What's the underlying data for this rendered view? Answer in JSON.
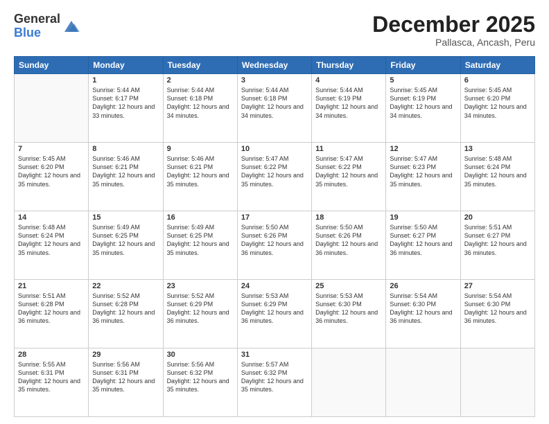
{
  "logo": {
    "general": "General",
    "blue": "Blue"
  },
  "title": "December 2025",
  "subtitle": "Pallasca, Ancash, Peru",
  "days_of_week": [
    "Sunday",
    "Monday",
    "Tuesday",
    "Wednesday",
    "Thursday",
    "Friday",
    "Saturday"
  ],
  "weeks": [
    [
      {
        "day": "",
        "sunrise": "",
        "sunset": "",
        "daylight": ""
      },
      {
        "day": "1",
        "sunrise": "Sunrise: 5:44 AM",
        "sunset": "Sunset: 6:17 PM",
        "daylight": "Daylight: 12 hours and 33 minutes."
      },
      {
        "day": "2",
        "sunrise": "Sunrise: 5:44 AM",
        "sunset": "Sunset: 6:18 PM",
        "daylight": "Daylight: 12 hours and 34 minutes."
      },
      {
        "day": "3",
        "sunrise": "Sunrise: 5:44 AM",
        "sunset": "Sunset: 6:18 PM",
        "daylight": "Daylight: 12 hours and 34 minutes."
      },
      {
        "day": "4",
        "sunrise": "Sunrise: 5:44 AM",
        "sunset": "Sunset: 6:19 PM",
        "daylight": "Daylight: 12 hours and 34 minutes."
      },
      {
        "day": "5",
        "sunrise": "Sunrise: 5:45 AM",
        "sunset": "Sunset: 6:19 PM",
        "daylight": "Daylight: 12 hours and 34 minutes."
      },
      {
        "day": "6",
        "sunrise": "Sunrise: 5:45 AM",
        "sunset": "Sunset: 6:20 PM",
        "daylight": "Daylight: 12 hours and 34 minutes."
      }
    ],
    [
      {
        "day": "7",
        "sunrise": "Sunrise: 5:45 AM",
        "sunset": "Sunset: 6:20 PM",
        "daylight": "Daylight: 12 hours and 35 minutes."
      },
      {
        "day": "8",
        "sunrise": "Sunrise: 5:46 AM",
        "sunset": "Sunset: 6:21 PM",
        "daylight": "Daylight: 12 hours and 35 minutes."
      },
      {
        "day": "9",
        "sunrise": "Sunrise: 5:46 AM",
        "sunset": "Sunset: 6:21 PM",
        "daylight": "Daylight: 12 hours and 35 minutes."
      },
      {
        "day": "10",
        "sunrise": "Sunrise: 5:47 AM",
        "sunset": "Sunset: 6:22 PM",
        "daylight": "Daylight: 12 hours and 35 minutes."
      },
      {
        "day": "11",
        "sunrise": "Sunrise: 5:47 AM",
        "sunset": "Sunset: 6:22 PM",
        "daylight": "Daylight: 12 hours and 35 minutes."
      },
      {
        "day": "12",
        "sunrise": "Sunrise: 5:47 AM",
        "sunset": "Sunset: 6:23 PM",
        "daylight": "Daylight: 12 hours and 35 minutes."
      },
      {
        "day": "13",
        "sunrise": "Sunrise: 5:48 AM",
        "sunset": "Sunset: 6:24 PM",
        "daylight": "Daylight: 12 hours and 35 minutes."
      }
    ],
    [
      {
        "day": "14",
        "sunrise": "Sunrise: 5:48 AM",
        "sunset": "Sunset: 6:24 PM",
        "daylight": "Daylight: 12 hours and 35 minutes."
      },
      {
        "day": "15",
        "sunrise": "Sunrise: 5:49 AM",
        "sunset": "Sunset: 6:25 PM",
        "daylight": "Daylight: 12 hours and 35 minutes."
      },
      {
        "day": "16",
        "sunrise": "Sunrise: 5:49 AM",
        "sunset": "Sunset: 6:25 PM",
        "daylight": "Daylight: 12 hours and 35 minutes."
      },
      {
        "day": "17",
        "sunrise": "Sunrise: 5:50 AM",
        "sunset": "Sunset: 6:26 PM",
        "daylight": "Daylight: 12 hours and 36 minutes."
      },
      {
        "day": "18",
        "sunrise": "Sunrise: 5:50 AM",
        "sunset": "Sunset: 6:26 PM",
        "daylight": "Daylight: 12 hours and 36 minutes."
      },
      {
        "day": "19",
        "sunrise": "Sunrise: 5:50 AM",
        "sunset": "Sunset: 6:27 PM",
        "daylight": "Daylight: 12 hours and 36 minutes."
      },
      {
        "day": "20",
        "sunrise": "Sunrise: 5:51 AM",
        "sunset": "Sunset: 6:27 PM",
        "daylight": "Daylight: 12 hours and 36 minutes."
      }
    ],
    [
      {
        "day": "21",
        "sunrise": "Sunrise: 5:51 AM",
        "sunset": "Sunset: 6:28 PM",
        "daylight": "Daylight: 12 hours and 36 minutes."
      },
      {
        "day": "22",
        "sunrise": "Sunrise: 5:52 AM",
        "sunset": "Sunset: 6:28 PM",
        "daylight": "Daylight: 12 hours and 36 minutes."
      },
      {
        "day": "23",
        "sunrise": "Sunrise: 5:52 AM",
        "sunset": "Sunset: 6:29 PM",
        "daylight": "Daylight: 12 hours and 36 minutes."
      },
      {
        "day": "24",
        "sunrise": "Sunrise: 5:53 AM",
        "sunset": "Sunset: 6:29 PM",
        "daylight": "Daylight: 12 hours and 36 minutes."
      },
      {
        "day": "25",
        "sunrise": "Sunrise: 5:53 AM",
        "sunset": "Sunset: 6:30 PM",
        "daylight": "Daylight: 12 hours and 36 minutes."
      },
      {
        "day": "26",
        "sunrise": "Sunrise: 5:54 AM",
        "sunset": "Sunset: 6:30 PM",
        "daylight": "Daylight: 12 hours and 36 minutes."
      },
      {
        "day": "27",
        "sunrise": "Sunrise: 5:54 AM",
        "sunset": "Sunset: 6:30 PM",
        "daylight": "Daylight: 12 hours and 36 minutes."
      }
    ],
    [
      {
        "day": "28",
        "sunrise": "Sunrise: 5:55 AM",
        "sunset": "Sunset: 6:31 PM",
        "daylight": "Daylight: 12 hours and 35 minutes."
      },
      {
        "day": "29",
        "sunrise": "Sunrise: 5:56 AM",
        "sunset": "Sunset: 6:31 PM",
        "daylight": "Daylight: 12 hours and 35 minutes."
      },
      {
        "day": "30",
        "sunrise": "Sunrise: 5:56 AM",
        "sunset": "Sunset: 6:32 PM",
        "daylight": "Daylight: 12 hours and 35 minutes."
      },
      {
        "day": "31",
        "sunrise": "Sunrise: 5:57 AM",
        "sunset": "Sunset: 6:32 PM",
        "daylight": "Daylight: 12 hours and 35 minutes."
      },
      {
        "day": "",
        "sunrise": "",
        "sunset": "",
        "daylight": ""
      },
      {
        "day": "",
        "sunrise": "",
        "sunset": "",
        "daylight": ""
      },
      {
        "day": "",
        "sunrise": "",
        "sunset": "",
        "daylight": ""
      }
    ]
  ]
}
